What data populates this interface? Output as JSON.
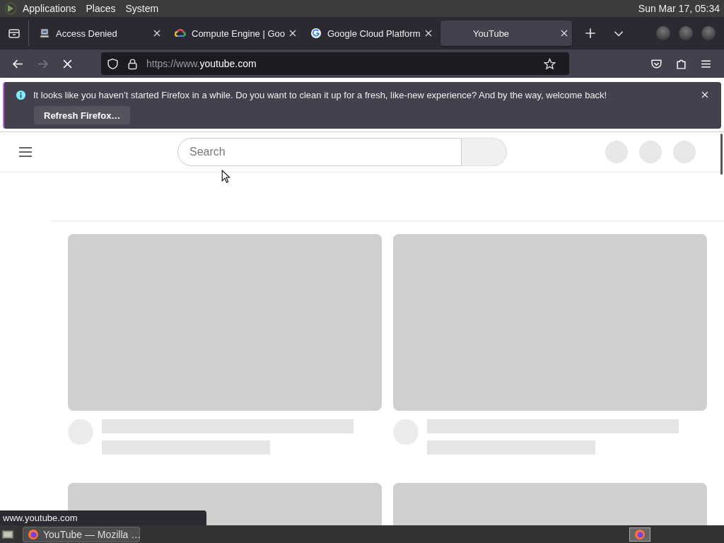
{
  "top_panel": {
    "menus": [
      "Applications",
      "Places",
      "System"
    ],
    "clock": "Sun Mar 17, 05:34"
  },
  "tabs": [
    {
      "title": "Access Denied",
      "kind": "computer",
      "selected": false
    },
    {
      "title": "Compute Engine | Goo",
      "kind": "cloud",
      "selected": false
    },
    {
      "title": "Google Cloud Platform",
      "kind": "google",
      "selected": false
    },
    {
      "title": "YouTube",
      "kind": "loading",
      "selected": true
    }
  ],
  "nav": {
    "back_disabled": false,
    "forward_disabled": true,
    "url_scheme": "https://www.",
    "url_host": "youtube.com"
  },
  "notification": {
    "message": "It looks like you haven’t started Firefox in a while. Do you want to clean it up for a fresh, like-new experience? And by the way, welcome back!",
    "button": "Refresh Firefox…"
  },
  "page": {
    "search": {
      "placeholder": "Search"
    },
    "cards": [
      {
        "kind": "placeholder"
      },
      {
        "kind": "placeholder"
      },
      {
        "kind": "thumbnail"
      },
      {
        "kind": "thumbnail"
      }
    ]
  },
  "status_url": "www.youtube.com",
  "taskbar": {
    "windows": [
      {
        "title": "YouTube — Mozilla …",
        "selected": true
      }
    ]
  }
}
